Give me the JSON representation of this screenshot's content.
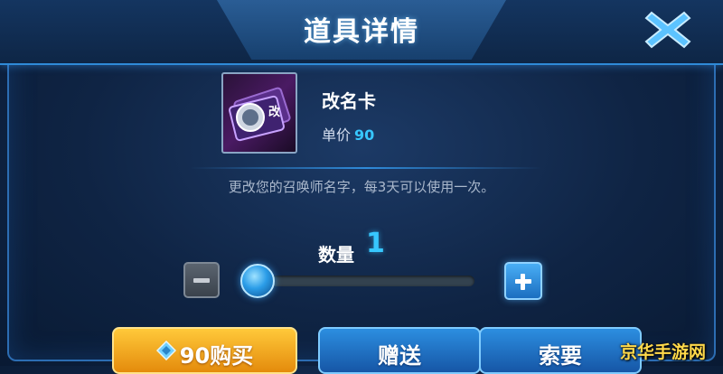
{
  "header": {
    "title": "道具详情"
  },
  "item": {
    "name": "改名卡",
    "price_label": "单价",
    "price_value": "90",
    "icon_text": "改",
    "description": "更改您的召唤师名字，每3天可以使用一次。"
  },
  "quantity": {
    "label": "数量",
    "value": "1",
    "slider_fraction": 0
  },
  "buttons": {
    "buy_label": "90购买",
    "gift_label": "赠送",
    "request_label": "索要"
  },
  "watermark": "京华手游网",
  "colors": {
    "accent": "#37c7ff",
    "buy_button": "#e48b0c",
    "action_button": "#1656a6"
  }
}
